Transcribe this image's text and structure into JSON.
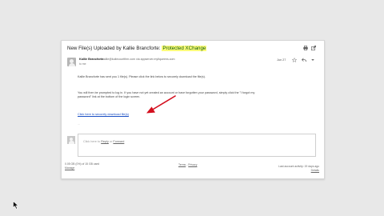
{
  "email": {
    "subject_prefix": "New File(s) Uploaded by Kallie Brancforte:",
    "subject_highlight": "Protected XChange",
    "sender_name": "Kallie Brancforte",
    "sender_email": "kallie@kuliecourtfirm.com via appserver.myfiqueens.com",
    "recipient": "to me",
    "date": "Jun 27",
    "body_line1": "Kallie Brancforte has sent you 1 file(s). Please click the link below to securely download the file(s).",
    "body_line2": "You will then be prompted to log in. If you have not yet created an account or have forgotten your password, simply click the \"I forgot my",
    "body_line3": "password\" link at the bottom of the login screen.",
    "link_text": "Click here to securely download file(s)",
    "ellipsis": "...",
    "reply_prefix": "Click here to",
    "reply_link": "Reply",
    "reply_or": "or",
    "forward_link": "Forward"
  },
  "footer": {
    "storage_line": "0.05 GB (0%) of 15 GB used",
    "manage_link": "Manage",
    "terms_link": "Terms",
    "separator": "-",
    "privacy_link": "Privacy",
    "activity_line": "Last account activity: 19 days ago",
    "details_link": "Details"
  },
  "colors": {
    "highlight_bg": "#fdfc7a",
    "highlight_text": "#0a5a0a",
    "link": "#1a4fc4",
    "arrow": "#d40f1e"
  },
  "icons": [
    "print-icon",
    "new-window-icon",
    "star-icon",
    "reply-icon",
    "more-icon",
    "avatar-icon",
    "mouse-cursor-icon"
  ]
}
